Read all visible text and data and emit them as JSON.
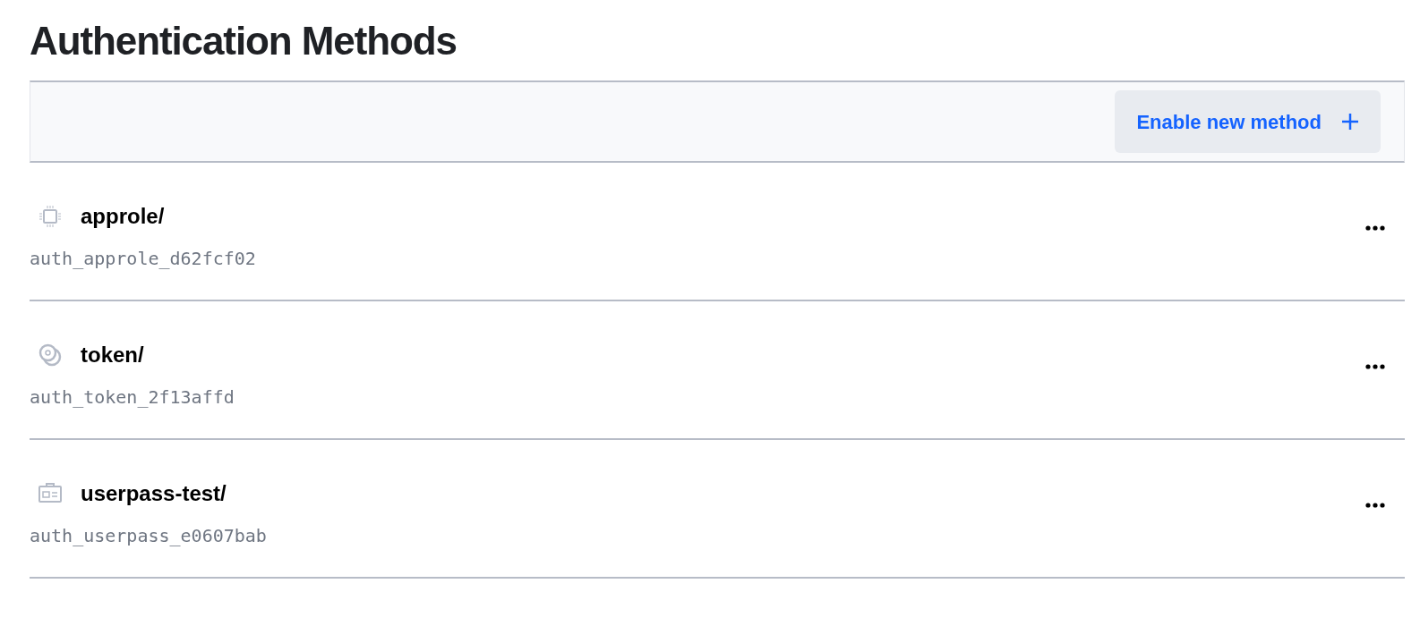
{
  "title": "Authentication Methods",
  "toolbar": {
    "button": "Enable new method"
  },
  "methods": [
    {
      "kind": "approle",
      "path": "approle/",
      "accessor": "auth_approle_d62fcf02"
    },
    {
      "kind": "token",
      "path": "token/",
      "accessor": "auth_token_2f13affd"
    },
    {
      "kind": "userpass",
      "path": "userpass-test/",
      "accessor": "auth_userpass_e0607bab"
    }
  ]
}
